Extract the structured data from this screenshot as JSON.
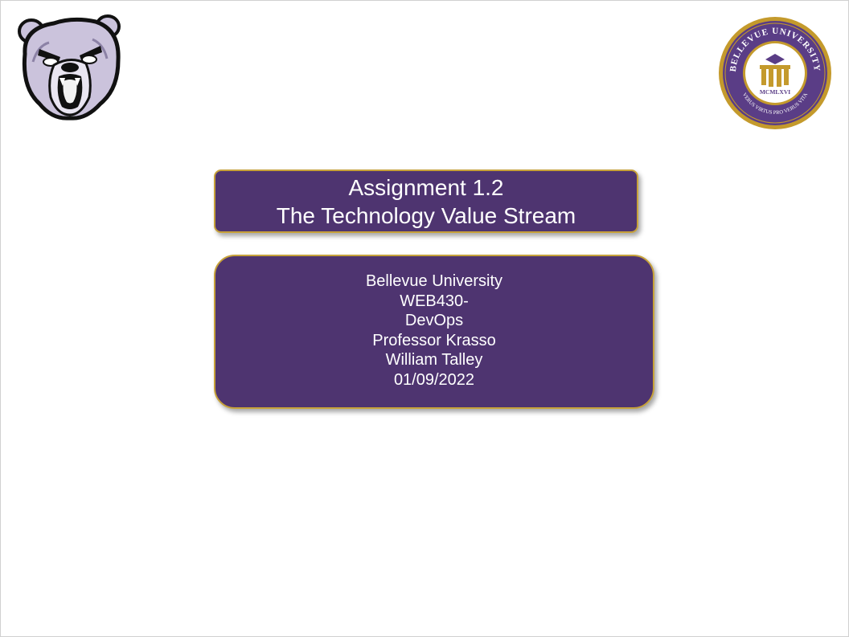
{
  "slide": {
    "title_box": {
      "lines": [
        "Assignment 1.2",
        "The Technology Value Stream"
      ]
    },
    "info_box": {
      "lines": [
        "Bellevue University",
        "WEB430-",
        "DevOps",
        "Professor Krasso",
        "William Talley",
        "01/09/2022"
      ]
    },
    "seal": {
      "top_text": "BELLEVUE UNIVERSITY",
      "bottom_text": "VERUS VIRTUS PRO VERUS VITA",
      "year": "MCMLXVI"
    },
    "colors": {
      "box_fill": "#4e3470",
      "box_border": "#c7a23a",
      "text": "#ffffff"
    },
    "icons": {
      "left_logo": "bruin-bear-mascot-icon",
      "right_logo": "bellevue-university-seal-icon"
    }
  }
}
